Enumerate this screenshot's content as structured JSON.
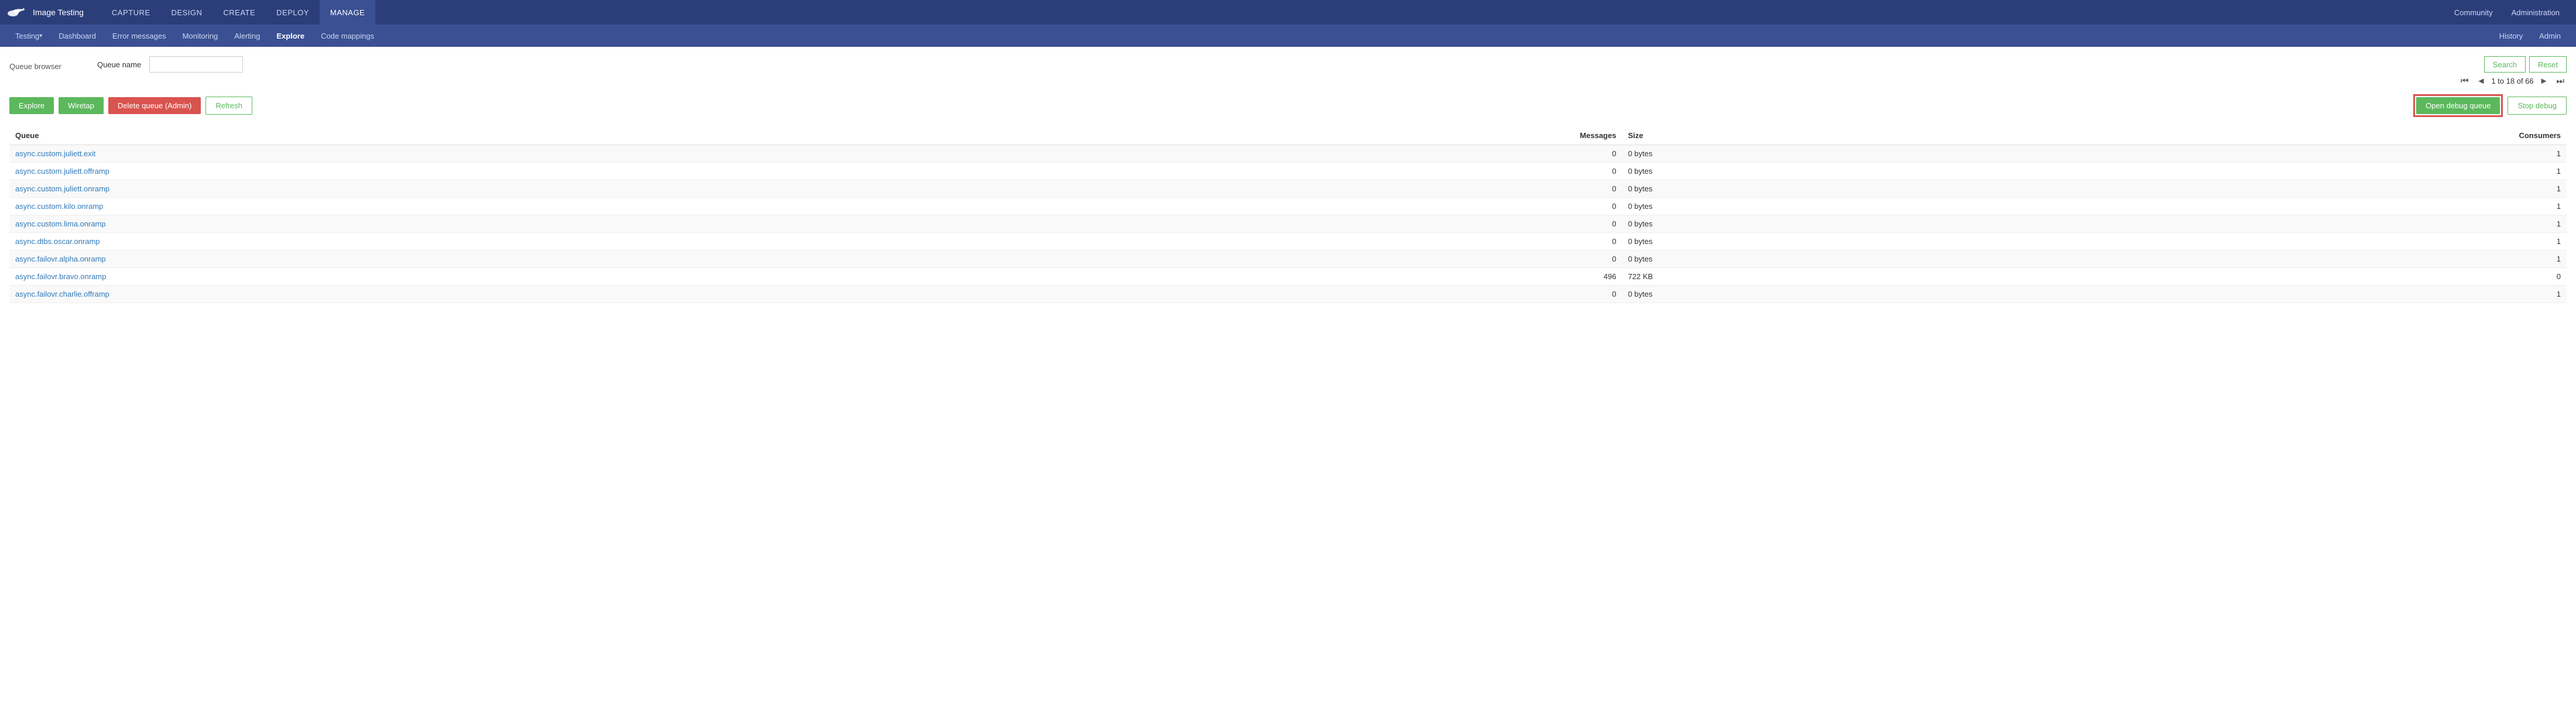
{
  "app": {
    "logo_text": "Image Testing",
    "main_nav": [
      {
        "label": "CAPTURE",
        "active": false
      },
      {
        "label": "DESIGN",
        "active": false
      },
      {
        "label": "CREATE",
        "active": false
      },
      {
        "label": "DEPLOY",
        "active": false
      },
      {
        "label": "MANAGE",
        "active": true
      }
    ],
    "right_nav": [
      {
        "label": "Community"
      },
      {
        "label": "Administration"
      }
    ]
  },
  "second_nav": {
    "items": [
      {
        "label": "Testing",
        "dropdown": true,
        "active": false
      },
      {
        "label": "Dashboard",
        "active": false
      },
      {
        "label": "Error messages",
        "active": false
      },
      {
        "label": "Monitoring",
        "active": false
      },
      {
        "label": "Alerting",
        "active": false
      },
      {
        "label": "Explore",
        "active": true
      },
      {
        "label": "Code mappings",
        "active": false
      }
    ],
    "right_items": [
      {
        "label": "History"
      },
      {
        "label": "Admin"
      }
    ]
  },
  "queue_browser": {
    "title": "Queue browser",
    "form": {
      "label": "Queue name",
      "placeholder": ""
    },
    "buttons": {
      "search": "Search",
      "reset": "Reset"
    },
    "pagination": {
      "text": "1 to 18 of 66"
    },
    "action_buttons": {
      "explore": "Explore",
      "wiretap": "Wiretap",
      "delete_queue": "Delete queue (Admin)",
      "refresh": "Refresh",
      "open_debug_queue": "Open debug queue",
      "stop_debug": "Stop debug"
    },
    "table": {
      "columns": [
        "Queue",
        "Messages",
        "Size",
        "Consumers"
      ],
      "rows": [
        {
          "name": "async.custom.juliett.exit",
          "messages": "0",
          "size": "0 bytes",
          "consumers": "1"
        },
        {
          "name": "async.custom.juliett.offramp",
          "messages": "0",
          "size": "0 bytes",
          "consumers": "1"
        },
        {
          "name": "async.custom.juliett.onramp",
          "messages": "0",
          "size": "0 bytes",
          "consumers": "1"
        },
        {
          "name": "async.custom.kilo.onramp",
          "messages": "0",
          "size": "0 bytes",
          "consumers": "1"
        },
        {
          "name": "async.custom.lima.onramp",
          "messages": "0",
          "size": "0 bytes",
          "consumers": "1"
        },
        {
          "name": "async.dtbs.oscar.onramp",
          "messages": "0",
          "size": "0 bytes",
          "consumers": "1"
        },
        {
          "name": "async.failovr.alpha.onramp",
          "messages": "0",
          "size": "0 bytes",
          "consumers": "1"
        },
        {
          "name": "async.failovr.bravo.onramp",
          "messages": "496",
          "size": "722 KB",
          "consumers": "0"
        },
        {
          "name": "async.failovr.charlie.offramp",
          "messages": "0",
          "size": "0 bytes",
          "consumers": "1"
        }
      ]
    }
  }
}
